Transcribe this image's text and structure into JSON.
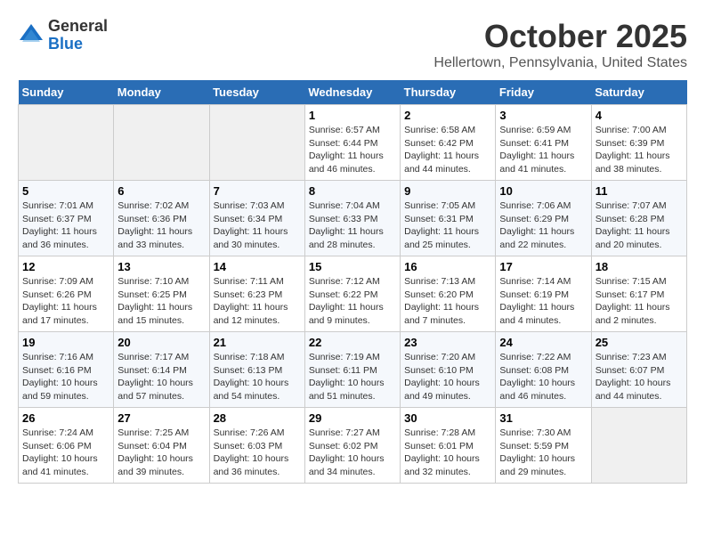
{
  "logo": {
    "general": "General",
    "blue": "Blue"
  },
  "header": {
    "month": "October 2025",
    "location": "Hellertown, Pennsylvania, United States"
  },
  "days_of_week": [
    "Sunday",
    "Monday",
    "Tuesday",
    "Wednesday",
    "Thursday",
    "Friday",
    "Saturday"
  ],
  "weeks": [
    [
      {
        "day": "",
        "content": ""
      },
      {
        "day": "",
        "content": ""
      },
      {
        "day": "",
        "content": ""
      },
      {
        "day": "1",
        "content": "Sunrise: 6:57 AM\nSunset: 6:44 PM\nDaylight: 11 hours and 46 minutes."
      },
      {
        "day": "2",
        "content": "Sunrise: 6:58 AM\nSunset: 6:42 PM\nDaylight: 11 hours and 44 minutes."
      },
      {
        "day": "3",
        "content": "Sunrise: 6:59 AM\nSunset: 6:41 PM\nDaylight: 11 hours and 41 minutes."
      },
      {
        "day": "4",
        "content": "Sunrise: 7:00 AM\nSunset: 6:39 PM\nDaylight: 11 hours and 38 minutes."
      }
    ],
    [
      {
        "day": "5",
        "content": "Sunrise: 7:01 AM\nSunset: 6:37 PM\nDaylight: 11 hours and 36 minutes."
      },
      {
        "day": "6",
        "content": "Sunrise: 7:02 AM\nSunset: 6:36 PM\nDaylight: 11 hours and 33 minutes."
      },
      {
        "day": "7",
        "content": "Sunrise: 7:03 AM\nSunset: 6:34 PM\nDaylight: 11 hours and 30 minutes."
      },
      {
        "day": "8",
        "content": "Sunrise: 7:04 AM\nSunset: 6:33 PM\nDaylight: 11 hours and 28 minutes."
      },
      {
        "day": "9",
        "content": "Sunrise: 7:05 AM\nSunset: 6:31 PM\nDaylight: 11 hours and 25 minutes."
      },
      {
        "day": "10",
        "content": "Sunrise: 7:06 AM\nSunset: 6:29 PM\nDaylight: 11 hours and 22 minutes."
      },
      {
        "day": "11",
        "content": "Sunrise: 7:07 AM\nSunset: 6:28 PM\nDaylight: 11 hours and 20 minutes."
      }
    ],
    [
      {
        "day": "12",
        "content": "Sunrise: 7:09 AM\nSunset: 6:26 PM\nDaylight: 11 hours and 17 minutes."
      },
      {
        "day": "13",
        "content": "Sunrise: 7:10 AM\nSunset: 6:25 PM\nDaylight: 11 hours and 15 minutes."
      },
      {
        "day": "14",
        "content": "Sunrise: 7:11 AM\nSunset: 6:23 PM\nDaylight: 11 hours and 12 minutes."
      },
      {
        "day": "15",
        "content": "Sunrise: 7:12 AM\nSunset: 6:22 PM\nDaylight: 11 hours and 9 minutes."
      },
      {
        "day": "16",
        "content": "Sunrise: 7:13 AM\nSunset: 6:20 PM\nDaylight: 11 hours and 7 minutes."
      },
      {
        "day": "17",
        "content": "Sunrise: 7:14 AM\nSunset: 6:19 PM\nDaylight: 11 hours and 4 minutes."
      },
      {
        "day": "18",
        "content": "Sunrise: 7:15 AM\nSunset: 6:17 PM\nDaylight: 11 hours and 2 minutes."
      }
    ],
    [
      {
        "day": "19",
        "content": "Sunrise: 7:16 AM\nSunset: 6:16 PM\nDaylight: 10 hours and 59 minutes."
      },
      {
        "day": "20",
        "content": "Sunrise: 7:17 AM\nSunset: 6:14 PM\nDaylight: 10 hours and 57 minutes."
      },
      {
        "day": "21",
        "content": "Sunrise: 7:18 AM\nSunset: 6:13 PM\nDaylight: 10 hours and 54 minutes."
      },
      {
        "day": "22",
        "content": "Sunrise: 7:19 AM\nSunset: 6:11 PM\nDaylight: 10 hours and 51 minutes."
      },
      {
        "day": "23",
        "content": "Sunrise: 7:20 AM\nSunset: 6:10 PM\nDaylight: 10 hours and 49 minutes."
      },
      {
        "day": "24",
        "content": "Sunrise: 7:22 AM\nSunset: 6:08 PM\nDaylight: 10 hours and 46 minutes."
      },
      {
        "day": "25",
        "content": "Sunrise: 7:23 AM\nSunset: 6:07 PM\nDaylight: 10 hours and 44 minutes."
      }
    ],
    [
      {
        "day": "26",
        "content": "Sunrise: 7:24 AM\nSunset: 6:06 PM\nDaylight: 10 hours and 41 minutes."
      },
      {
        "day": "27",
        "content": "Sunrise: 7:25 AM\nSunset: 6:04 PM\nDaylight: 10 hours and 39 minutes."
      },
      {
        "day": "28",
        "content": "Sunrise: 7:26 AM\nSunset: 6:03 PM\nDaylight: 10 hours and 36 minutes."
      },
      {
        "day": "29",
        "content": "Sunrise: 7:27 AM\nSunset: 6:02 PM\nDaylight: 10 hours and 34 minutes."
      },
      {
        "day": "30",
        "content": "Sunrise: 7:28 AM\nSunset: 6:01 PM\nDaylight: 10 hours and 32 minutes."
      },
      {
        "day": "31",
        "content": "Sunrise: 7:30 AM\nSunset: 5:59 PM\nDaylight: 10 hours and 29 minutes."
      },
      {
        "day": "",
        "content": ""
      }
    ]
  ]
}
